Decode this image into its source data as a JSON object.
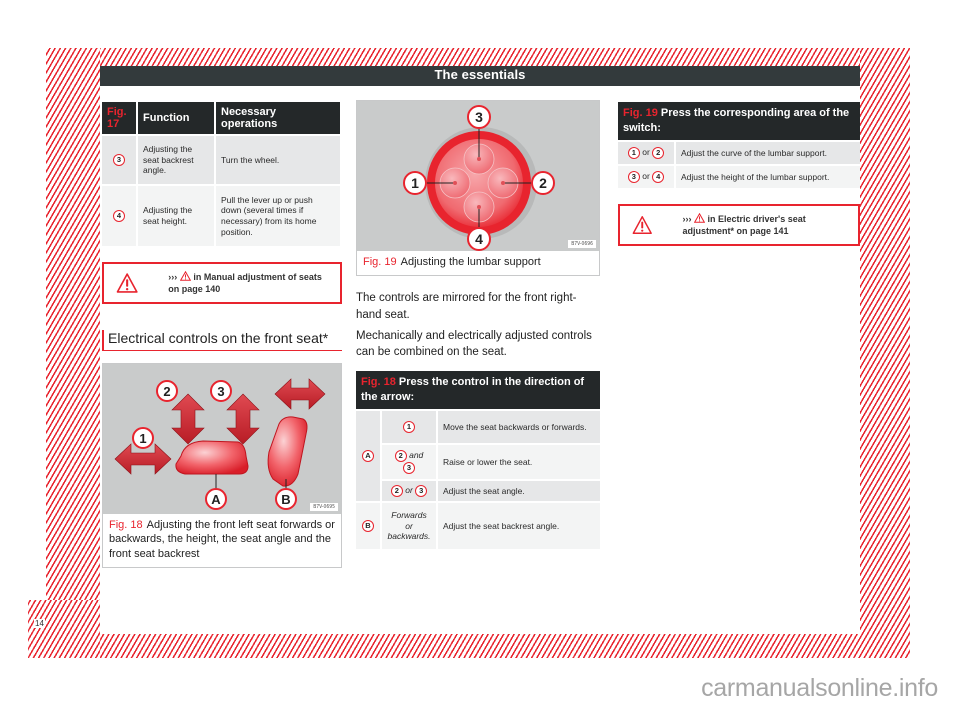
{
  "header": {
    "title": "The essentials"
  },
  "table17": {
    "fig_label": "Fig. 17",
    "col_function": "Function",
    "col_operations": "Necessary operations",
    "rows": [
      {
        "num": "3",
        "function": "Adjusting the seat backrest angle.",
        "operation": "Turn the wheel."
      },
      {
        "num": "4",
        "function": "Adjusting the seat height.",
        "operation": "Pull the lever up or push down (several times if necessary) from its home position."
      }
    ]
  },
  "warning1": {
    "prefix": "›››",
    "text": "in Manual adjustment of seats on page 140"
  },
  "section": {
    "title": "Electrical controls on the front seat*"
  },
  "figure18": {
    "labels": [
      "1",
      "2",
      "3",
      "A",
      "B"
    ],
    "code": "B7V-0695",
    "fig_label": "Fig. 18",
    "caption": "Adjusting the front left seat forwards or backwards, the height, the seat angle and the front seat backrest"
  },
  "figure19": {
    "labels": [
      "1",
      "2",
      "3",
      "4"
    ],
    "code": "B7V-0696",
    "fig_label": "Fig. 19",
    "caption": "Adjusting the lumbar support"
  },
  "body": {
    "para1": "The controls are mirrored for the front right-hand seat.",
    "para2": "Mechanically and electrically adjusted controls can be combined on the seat."
  },
  "table18": {
    "fig_label": "Fig. 18",
    "header": "Press the control in the direction of the arrow:",
    "groups": [
      {
        "letter": "A",
        "rows": [
          {
            "control": {
              "a": "1",
              "join": "",
              "b": ""
            },
            "action": "Move the seat backwards or forwards."
          },
          {
            "control": {
              "a": "2",
              "join": "and",
              "b": "3"
            },
            "action": "Raise or lower the seat."
          },
          {
            "control": {
              "a": "2",
              "join": "or",
              "b": "3"
            },
            "action": "Adjust the seat angle."
          }
        ]
      },
      {
        "letter": "B",
        "rows": [
          {
            "control_text": "Forwards or backwards.",
            "action": "Adjust the seat backrest angle."
          }
        ]
      }
    ]
  },
  "table19": {
    "fig_label": "Fig. 19",
    "header": "Press the corresponding area of the switch:",
    "rows": [
      {
        "a": "1",
        "join": "or",
        "b": "2",
        "action": "Adjust the curve of the lumbar support."
      },
      {
        "a": "3",
        "join": "or",
        "b": "4",
        "action": "Adjust the height of the lumbar support."
      }
    ]
  },
  "warning2": {
    "prefix": "›››",
    "text": "in Electric driver's seat adjustment* on page 141"
  },
  "footer": {
    "page_number": "14",
    "watermark": "carmanualsonline.info"
  }
}
